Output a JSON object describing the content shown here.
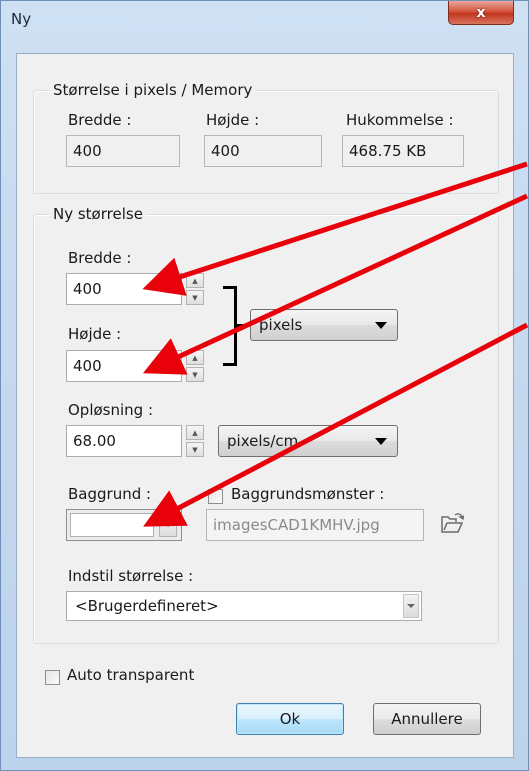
{
  "window": {
    "title": "Ny",
    "close_glyph": "x"
  },
  "memory_group": {
    "title": "Størrelse i pixels / Memory",
    "width_label": "Bredde :",
    "width_value": "400",
    "height_label": "Højde :",
    "height_value": "400",
    "memory_label": "Hukommelse :",
    "memory_value": "468.75 KB"
  },
  "new_size_group": {
    "title": "Ny størrelse",
    "width_label": "Bredde :",
    "width_value": "400",
    "height_label": "Højde :",
    "height_value": "400",
    "unit_selected": "pixels",
    "resolution_label": "Opløsning :",
    "resolution_value": "68.00",
    "resolution_unit_selected": "pixels/cm",
    "background_label": "Baggrund :",
    "background_color": "#ffffff",
    "pattern_label": "Baggrundsmønster :",
    "pattern_file": "imagesCAD1KMHV.jpg",
    "preset_label": "Indstil størrelse :",
    "preset_selected": "<Brugerdefineret>"
  },
  "options": {
    "auto_transparent_label": "Auto transparent",
    "auto_transparent_checked": false,
    "pattern_checked": false
  },
  "buttons": {
    "ok_label": "Ok",
    "cancel_label": "Annullere"
  },
  "annotation": {
    "arrow_color": "#e8000b"
  }
}
